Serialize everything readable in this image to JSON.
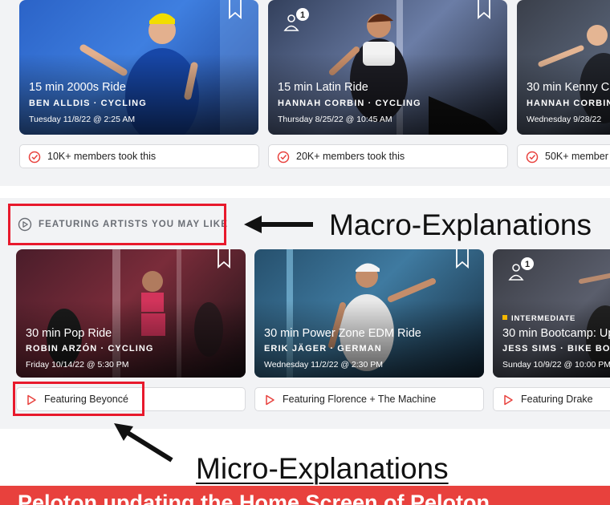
{
  "top_row": {
    "cards": [
      {
        "title": "15 min 2000s Ride",
        "meta": "BEN ALLDIS  ·  CYCLING",
        "date": "Tuesday 11/8/22 @ 2:25 AM"
      },
      {
        "title": "15 min Latin Ride",
        "meta": "HANNAH CORBIN  ·  CYCLING",
        "date": "Thursday 8/25/22 @ 10:45 AM",
        "badge_count": "1"
      },
      {
        "title": "30 min Kenny C",
        "meta": "HANNAH CORBIN",
        "date": "Wednesday 9/28/22"
      }
    ],
    "pills": [
      "10K+ members took this",
      "20K+ members took this",
      "50K+ member"
    ]
  },
  "featured_section": {
    "label": "FEATURING ARTISTS YOU MAY LIKE",
    "cards": [
      {
        "title": "30 min Pop Ride",
        "meta": "ROBIN ARZÓN  ·  CYCLING",
        "date": "Friday 10/14/22 @ 5:30 PM"
      },
      {
        "title": "30 min Power Zone EDM Ride",
        "meta": "ERIK JÄGER  ·  GERMAN",
        "date": "Wednesday 11/2/22 @ 2:30 PM"
      },
      {
        "title": "30 min Bootcamp: Up",
        "meta": "JESS SIMS  ·  BIKE BOO",
        "date": "Sunday 10/9/22 @ 10:00 PM",
        "level": "INTERMEDIATE",
        "badge_count": "1"
      }
    ],
    "pills": [
      "Featuring Beyoncé",
      "Featuring Florence + The Machine",
      "Featuring Drake"
    ]
  },
  "annotations": {
    "macro": "Macro-Explanations",
    "micro": "Micro-Explanations"
  },
  "banner": {
    "text": "Peloton updating the Home Screen of Peloton"
  },
  "colors": {
    "annotation_red": "#e8192c",
    "pill_icon_red": "#e8413d",
    "banner_red": "#e8413d",
    "level_yellow": "#f5b800"
  }
}
